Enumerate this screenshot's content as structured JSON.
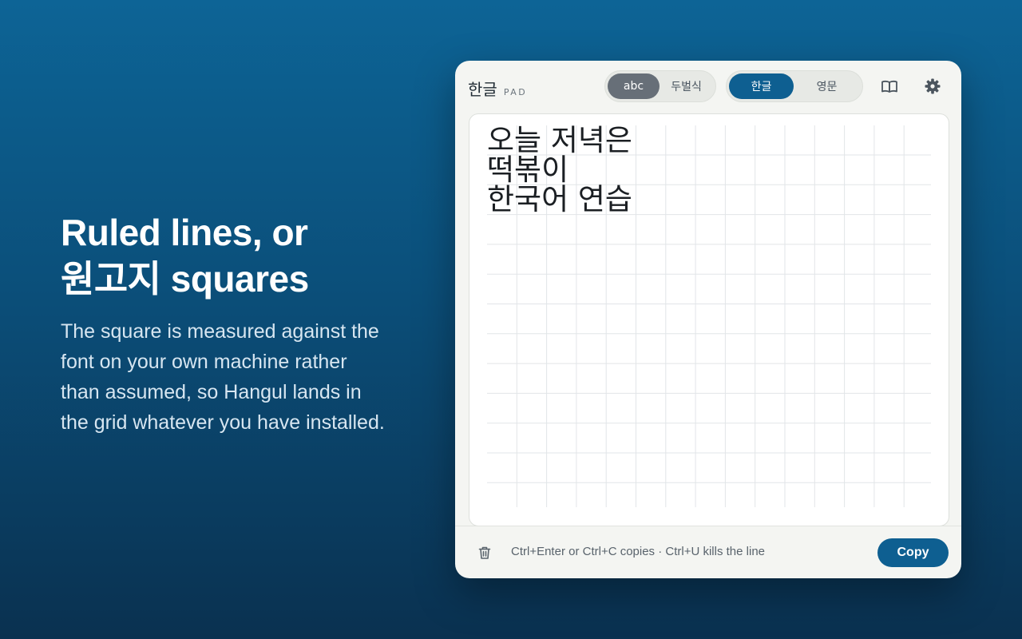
{
  "promo": {
    "heading_line1": "Ruled lines, or",
    "heading_line2": "원고지 squares",
    "body_lines": [
      "The square is measured against the",
      "font on your own machine rather",
      "than assumed, so Hangul lands in",
      "the grid whatever you have installed."
    ]
  },
  "app": {
    "logo_text": "한글",
    "logo_sub": "PAD",
    "input_mode": {
      "options": [
        "abc",
        "두벌식"
      ],
      "selected": "abc"
    },
    "language": {
      "options": [
        "한글",
        "영문"
      ],
      "selected": "한글"
    },
    "icons": {
      "dictionary": "book-open-icon",
      "settings": "gear-icon",
      "clear": "trash-icon"
    },
    "editor_lines": [
      "오늘 저녁은",
      "떡볶이",
      "한국어 연습"
    ],
    "footer_hint": "Ctrl+Enter or Ctrl+C copies · Ctrl+U kills the line",
    "copy_label": "Copy"
  },
  "colors": {
    "accent": "#0e5f91",
    "selected_gray": "#676f78",
    "grid_line": "#e2e5e8",
    "background_top": "#0d6496",
    "background_bottom": "#0a3150"
  }
}
